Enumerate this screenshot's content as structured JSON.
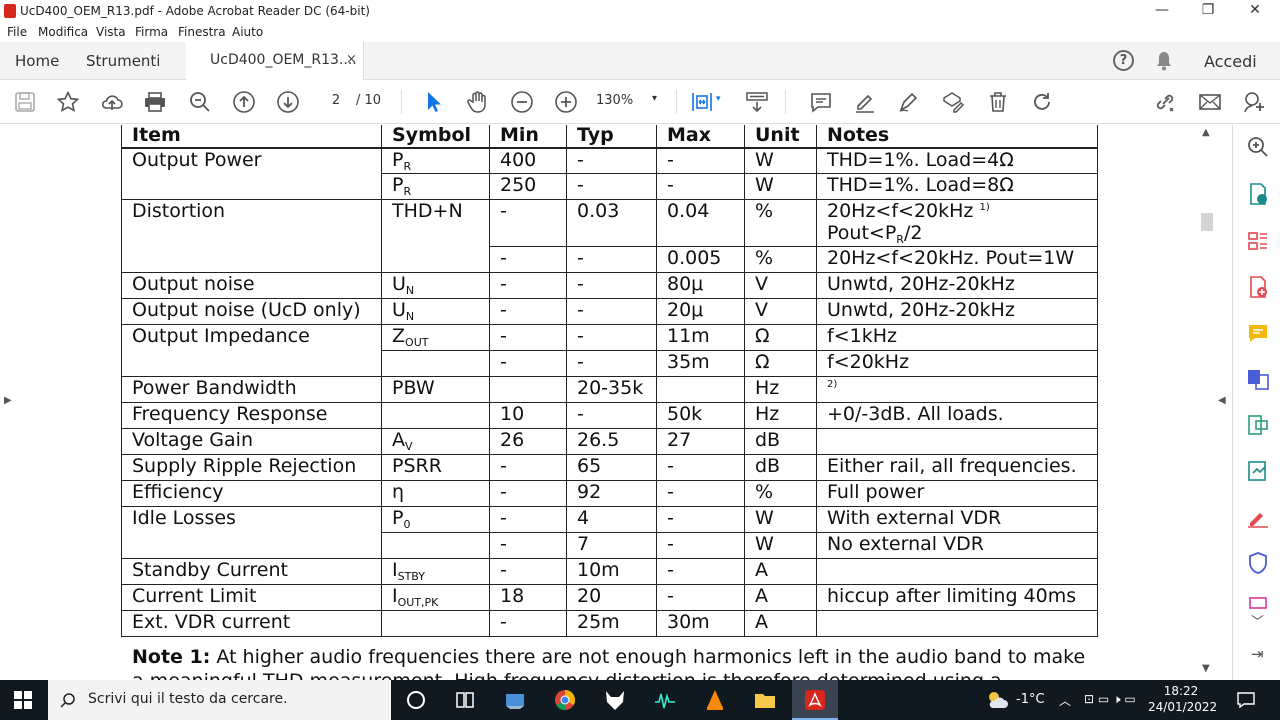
{
  "window": {
    "title": "UcD400_OEM_R13.pdf - Adobe Acrobat Reader DC (64-bit)",
    "minimize": "—",
    "restore": "❐",
    "close": "✕"
  },
  "menu": [
    "File",
    "Modifica",
    "Vista",
    "Firma",
    "Finestra",
    "Aiuto"
  ],
  "tabs": {
    "home": "Home",
    "tools": "Strumenti",
    "doc": "UcD400_OEM_R13....",
    "close": "×",
    "help": "?",
    "signin": "Accedi"
  },
  "toolbar": {
    "page_current": "2",
    "page_total": "/ 10",
    "zoom": "130%",
    "zoom_arrow": "▾"
  },
  "table": {
    "headers": [
      "Item",
      "Symbol",
      "Min",
      "Typ",
      "Max",
      "Unit",
      "Notes"
    ],
    "rows": [
      {
        "item": "Output Power",
        "sym": "P",
        "sub": "R",
        "min": "400",
        "typ": "-",
        "max": "-",
        "unit": "W",
        "notes": "THD=1%. Load=4Ω"
      },
      {
        "item": "",
        "sym": "P",
        "sub": "R",
        "min": "250",
        "typ": "-",
        "max": "-",
        "unit": "W",
        "notes": "THD=1%. Load=8Ω"
      },
      {
        "item": "Distortion",
        "sym": "THD+N",
        "sub": "",
        "min": "-",
        "typ": "0.03",
        "max": "0.04",
        "unit": "%",
        "notes": "20Hz<f<20kHz",
        "notes_sup": "1)",
        "notes2": "Pout<P",
        "notes2_sub": "R",
        "notes2_tail": "/2"
      },
      {
        "item": "",
        "sym": "",
        "sub": "",
        "min": "-",
        "typ": "-",
        "max": "0.005",
        "unit": "%",
        "notes": "20Hz<f<20kHz. Pout=1W"
      },
      {
        "item": "Output noise",
        "sym": "U",
        "sub": "N",
        "min": "-",
        "typ": "-",
        "max": "80μ",
        "unit": "V",
        "notes": "Unwtd, 20Hz-20kHz"
      },
      {
        "item": "Output noise (UcD only)",
        "sym": "U",
        "sub": "N",
        "min": "-",
        "typ": "-",
        "max": "20μ",
        "unit": "V",
        "notes": "Unwtd, 20Hz-20kHz"
      },
      {
        "item": "Output Impedance",
        "sym": "Z",
        "sub": "OUT",
        "min": "-",
        "typ": "-",
        "max": "11m",
        "unit": "Ω",
        "notes": "f<1kHz"
      },
      {
        "item": "",
        "sym": "",
        "sub": "",
        "min": "-",
        "typ": "-",
        "max": "35m",
        "unit": "Ω",
        "notes": "f<20kHz"
      },
      {
        "item": "Power Bandwidth",
        "sym": "PBW",
        "sub": "",
        "min": "",
        "typ": "20-35k",
        "max": "",
        "unit": "Hz",
        "notes": "",
        "notes_sup": "2)"
      },
      {
        "item": "Frequency Response",
        "sym": "",
        "sub": "",
        "min": "10",
        "typ": "-",
        "max": "50k",
        "unit": "Hz",
        "notes": "+0/-3dB. All loads."
      },
      {
        "item": "Voltage Gain",
        "sym": "A",
        "sub": "V",
        "min": "26",
        "typ": "26.5",
        "max": "27",
        "unit": "dB",
        "notes": ""
      },
      {
        "item": "Supply Ripple Rejection",
        "sym": "PSRR",
        "sub": "",
        "min": "-",
        "typ": "65",
        "max": "-",
        "unit": "dB",
        "notes": "Either rail, all frequencies."
      },
      {
        "item": "Efficiency",
        "sym": "η",
        "sub": "",
        "min": "-",
        "typ": "92",
        "max": "-",
        "unit": "%",
        "notes": "Full power"
      },
      {
        "item": "Idle Losses",
        "sym": "P",
        "sub": "0",
        "min": "-",
        "typ": "4",
        "max": "-",
        "unit": "W",
        "notes": "With external VDR"
      },
      {
        "item": "",
        "sym": "",
        "sub": "",
        "min": "-",
        "typ": "7",
        "max": "-",
        "unit": "W",
        "notes": "No external VDR"
      },
      {
        "item": "Standby Current",
        "sym": "I",
        "sub": "STBY",
        "min": "-",
        "typ": "10m",
        "max": "-",
        "unit": "A",
        "notes": ""
      },
      {
        "item": "Current Limit",
        "sym": "I",
        "sub": "OUT,PK",
        "min": "18",
        "typ": "20",
        "max": "-",
        "unit": "A",
        "notes": "hiccup after limiting 40ms"
      },
      {
        "item": "Ext. VDR current",
        "sym": "",
        "sub": "",
        "min": "-",
        "typ": "25m",
        "max": "30m",
        "unit": "A",
        "notes": ""
      }
    ]
  },
  "note": {
    "label": "Note 1:",
    "text": " At higher audio frequencies there are not enough harmonics left in the audio band to make",
    "text2": "a meaningful THD measurement. High frequency distortion is therefore determined using a"
  },
  "taskbar": {
    "search_placeholder": "Scrivi qui il testo da cercare.",
    "weather": "-1°C",
    "time": "18:22",
    "date": "24/01/2022"
  },
  "colors": {
    "acrobat_red": "#d7261e",
    "accent_blue": "#1473e6",
    "taskbar": "#101820"
  }
}
